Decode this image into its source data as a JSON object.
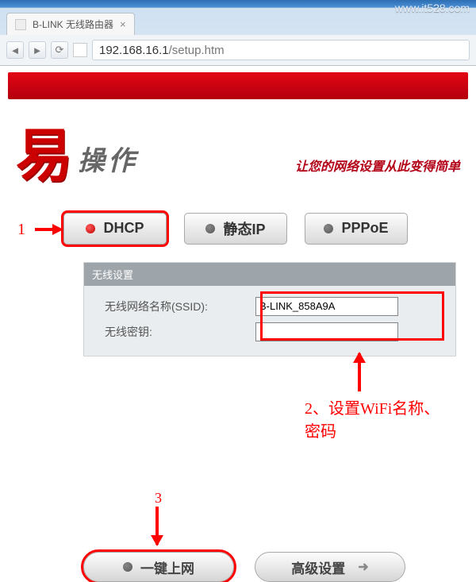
{
  "watermark": "www.it528.com",
  "browser": {
    "tab_title": "B-LINK 无线路由器",
    "url_host": "192.168.16.1",
    "url_path": "/setup.htm"
  },
  "hero": {
    "big_char": "易",
    "word": "操作",
    "subtitle": "让您的网络设置从此变得简单"
  },
  "modes": {
    "dhcp": "DHCP",
    "static": "静态IP",
    "pppoe": "PPPoE"
  },
  "wifi_panel": {
    "title": "无线设置",
    "ssid_label": "无线网络名称(SSID):",
    "ssid_value": "B-LINK_858A9A",
    "key_label": "无线密钥:",
    "key_value": ""
  },
  "annotations": {
    "step1": "1",
    "step2": "2、设置WiFi名称、密码",
    "step3": "3"
  },
  "actions": {
    "connect": "一键上网",
    "advanced": "高级设置"
  }
}
